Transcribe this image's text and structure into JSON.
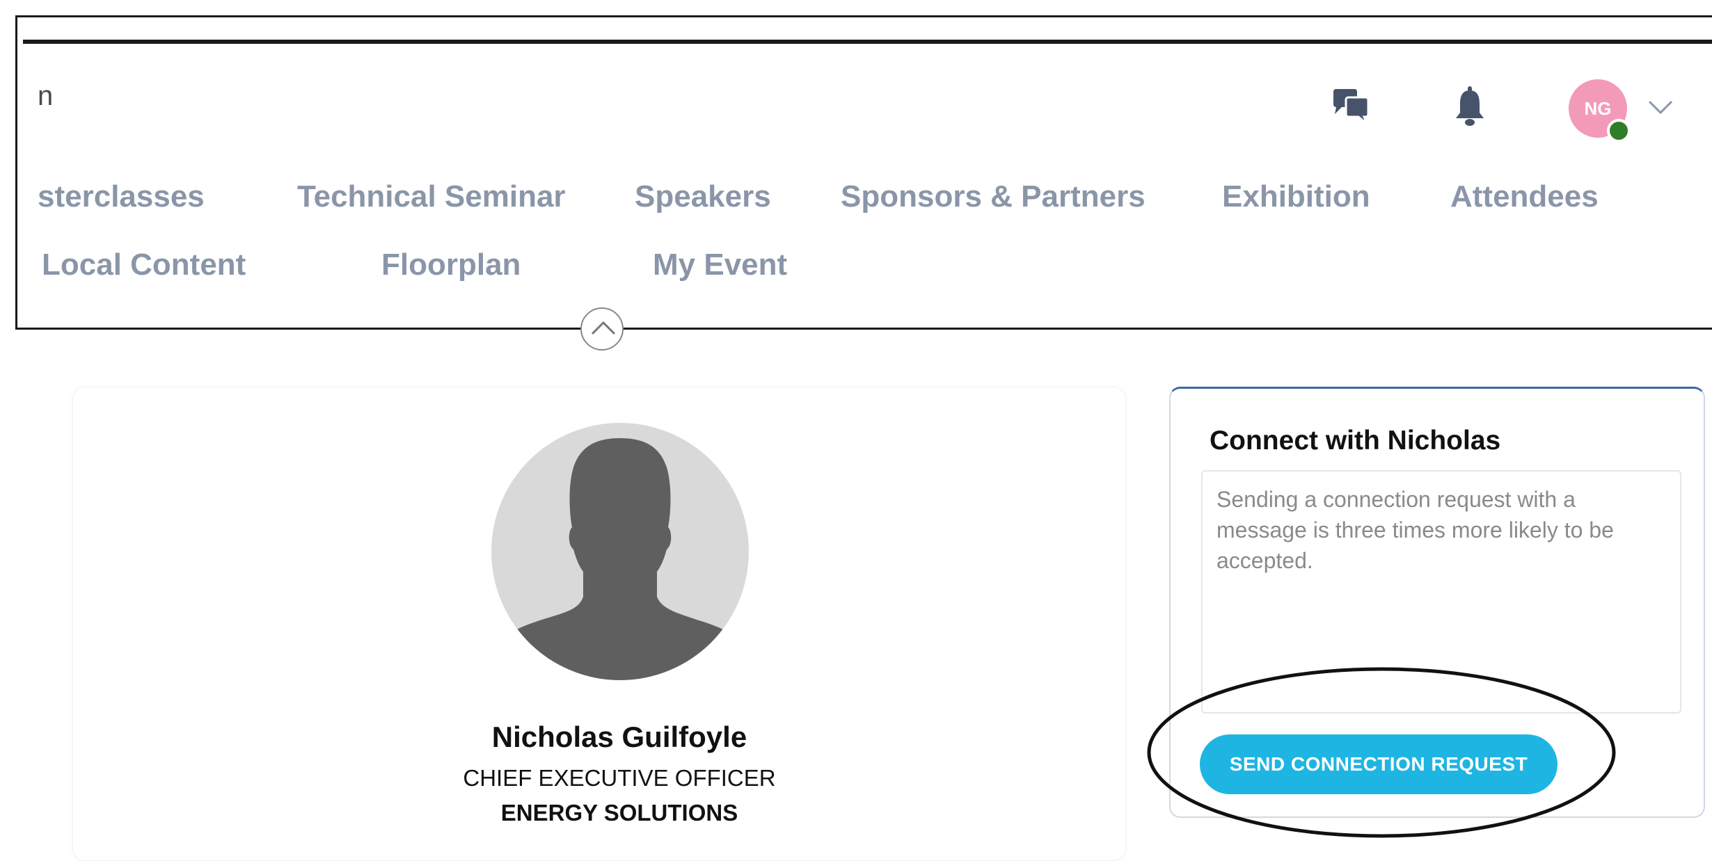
{
  "header": {
    "search_fragment": "n",
    "user_initials": "NG",
    "nav_row1": [
      "sterclasses",
      "Technical Seminar",
      "Speakers",
      "Sponsors & Partners",
      "Exhibition",
      "Attendees"
    ],
    "nav_row2": [
      "Local Content",
      "Floorplan",
      "My Event"
    ]
  },
  "icons": {
    "chat": "chat-bubbles-icon",
    "bell": "bell-icon",
    "chevron_down": "chevron-down-icon",
    "collapse": "chevron-up-icon"
  },
  "profile": {
    "name": "Nicholas Guilfoyle",
    "job_title": "CHIEF EXECUTIVE OFFICER",
    "company": "ENERGY SOLUTIONS"
  },
  "connect": {
    "heading": "Connect with Nicholas",
    "message_placeholder": "Sending a connection request with a message is three times more likely to be accepted.",
    "button_label": "SEND CONNECTION REQUEST"
  },
  "colors": {
    "nav_text": "#8a96a8",
    "avatar_bg": "#f49ab9",
    "presence_online": "#2f7d27",
    "primary_button": "#1fb5e3"
  }
}
